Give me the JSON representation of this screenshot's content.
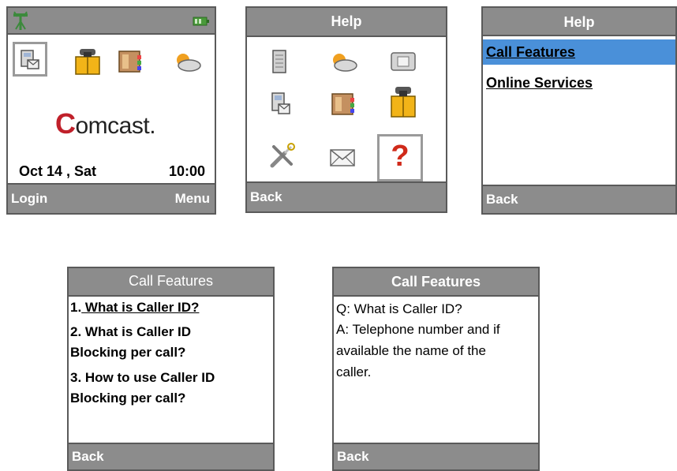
{
  "screen1": {
    "brand": "comcast",
    "brand_c": "C",
    "brand_rest": "omcast.",
    "date": "Oct 14 , Sat",
    "time": "10:00",
    "soft_left": "Login",
    "soft_right": "Menu",
    "icons": [
      "signal-icon",
      "battery-icon",
      "contacts-icon",
      "phone-book-icon",
      "address-book-icon",
      "weather-icon"
    ]
  },
  "screen2": {
    "title": "Help",
    "soft_left": "Back",
    "icons": [
      "notebook-icon",
      "weather-icon",
      "speaker-icon",
      "contacts-icon",
      "address-book-icon",
      "phone-book-icon",
      "tools-icon",
      "mail-icon",
      "help-icon"
    ],
    "help_glyph": "?"
  },
  "screen3": {
    "title": "Help",
    "items": [
      "Call Features",
      "Online Services"
    ],
    "soft_left": "Back",
    "highlight_color": "#4a90d9"
  },
  "screen4": {
    "title": "Call Features",
    "q1_num": "1.",
    "q1_text": " What is Caller ID?",
    "q2_line1": "2. What is Caller ID",
    "q2_line2": "Blocking per call?",
    "q3_line1": "3. How to use Caller ID",
    "q3_line2": "Blocking per call?",
    "soft_left": "Back"
  },
  "screen5": {
    "title": "Call Features",
    "lines": [
      "Q: What is Caller ID?",
      "A: Telephone number and if",
      "available the name of the",
      "caller."
    ],
    "soft_left": "Back"
  },
  "colors": {
    "bar_gray": "#8c8c8c",
    "border_gray": "#5a5a5a",
    "brand_red": "#c0202a",
    "help_red": "#d02a1a"
  }
}
